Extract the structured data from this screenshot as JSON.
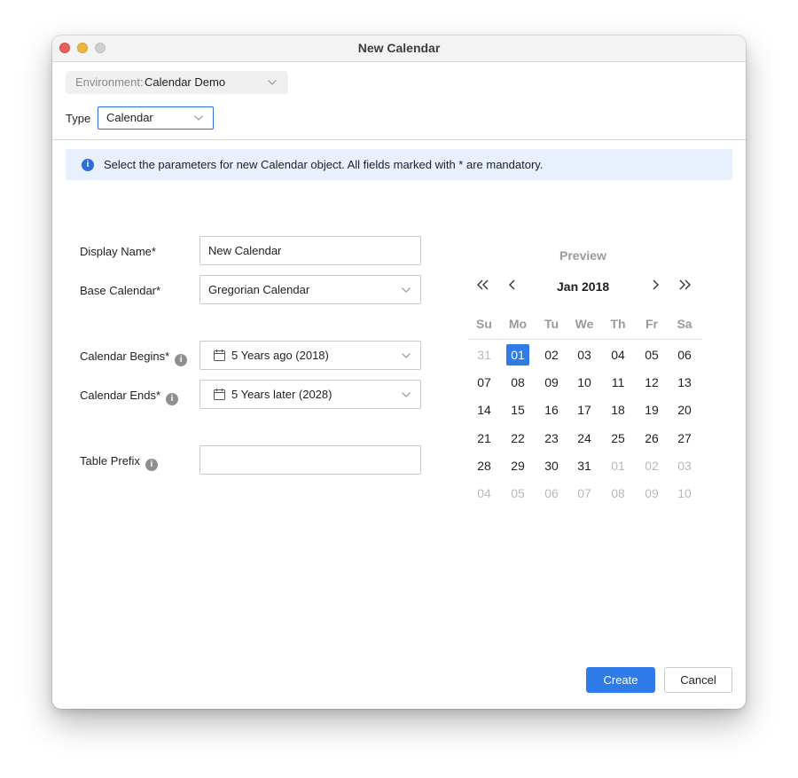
{
  "window": {
    "title": "New Calendar"
  },
  "environment": {
    "label": "Environment:",
    "value": "Calendar Demo"
  },
  "type": {
    "label": "Type",
    "value": "Calendar"
  },
  "info": {
    "text": "Select the parameters for new Calendar object. All fields marked with * are mandatory."
  },
  "form": {
    "display_name": {
      "label": "Display Name*",
      "value": "New Calendar"
    },
    "base_calendar": {
      "label": "Base Calendar*",
      "value": "Gregorian Calendar"
    },
    "calendar_begins": {
      "label": "Calendar Begins*",
      "value": "5 Years ago (2018)"
    },
    "calendar_ends": {
      "label": "Calendar Ends*",
      "value": "5 Years later (2028)"
    },
    "table_prefix": {
      "label": "Table Prefix",
      "value": ""
    }
  },
  "preview": {
    "title": "Preview",
    "month": "Jan 2018",
    "weekdays": [
      "Su",
      "Mo",
      "Tu",
      "We",
      "Th",
      "Fr",
      "Sa"
    ],
    "weeks": [
      [
        {
          "d": "31",
          "m": true
        },
        {
          "d": "01",
          "sel": true
        },
        {
          "d": "02"
        },
        {
          "d": "03"
        },
        {
          "d": "04"
        },
        {
          "d": "05"
        },
        {
          "d": "06"
        }
      ],
      [
        {
          "d": "07"
        },
        {
          "d": "08"
        },
        {
          "d": "09"
        },
        {
          "d": "10"
        },
        {
          "d": "11"
        },
        {
          "d": "12"
        },
        {
          "d": "13"
        }
      ],
      [
        {
          "d": "14"
        },
        {
          "d": "15"
        },
        {
          "d": "16"
        },
        {
          "d": "17"
        },
        {
          "d": "18"
        },
        {
          "d": "19"
        },
        {
          "d": "20"
        }
      ],
      [
        {
          "d": "21"
        },
        {
          "d": "22"
        },
        {
          "d": "23"
        },
        {
          "d": "24"
        },
        {
          "d": "25"
        },
        {
          "d": "26"
        },
        {
          "d": "27"
        }
      ],
      [
        {
          "d": "28"
        },
        {
          "d": "29"
        },
        {
          "d": "30"
        },
        {
          "d": "31"
        },
        {
          "d": "01",
          "m": true
        },
        {
          "d": "02",
          "m": true
        },
        {
          "d": "03",
          "m": true
        }
      ],
      [
        {
          "d": "04",
          "m": true
        },
        {
          "d": "05",
          "m": true
        },
        {
          "d": "06",
          "m": true
        },
        {
          "d": "07",
          "m": true
        },
        {
          "d": "08",
          "m": true
        },
        {
          "d": "09",
          "m": true
        },
        {
          "d": "10",
          "m": true
        }
      ]
    ]
  },
  "buttons": {
    "create": "Create",
    "cancel": "Cancel"
  },
  "colors": {
    "accent": "#2f7bea",
    "info_bg": "#e8f0fd",
    "muted": "#b9b9b9"
  }
}
